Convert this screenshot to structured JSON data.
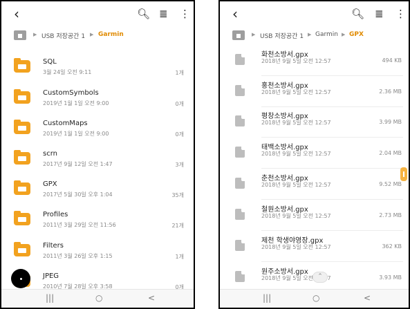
{
  "left": {
    "breadcrumb": {
      "storage": "USB 저장공간 1",
      "current": "Garmin"
    },
    "folders": [
      {
        "name": "SQL",
        "date": "3월 24일 오전 9:11",
        "count": "1개"
      },
      {
        "name": "CustomSymbols",
        "date": "2019년 1월 1일 오전 9:00",
        "count": "0개"
      },
      {
        "name": "CustomMaps",
        "date": "2019년 1월 1일 오전 9:00",
        "count": "0개"
      },
      {
        "name": "scrn",
        "date": "2017년 9월 12일 오전 1:47",
        "count": "3개"
      },
      {
        "name": "GPX",
        "date": "2017년 5월 30일 오후 1:04",
        "count": "35개"
      },
      {
        "name": "Profiles",
        "date": "2011년 3월 29일 오전 11:56",
        "count": "21개"
      },
      {
        "name": "Filters",
        "date": "2011년 3월 26일 오후 1:15",
        "count": "1개"
      },
      {
        "name": "JPEG",
        "date": "2010년 7월 28일 오후 3:58",
        "count": "0개"
      }
    ]
  },
  "right": {
    "breadcrumb": {
      "storage": "USB 저장공간 1",
      "middle": "Garmin",
      "current": "GPX"
    },
    "files": [
      {
        "name": "화천소방서.gpx",
        "date": "2018년 9월 5일 오전 12:57",
        "size": "494 KB"
      },
      {
        "name": "홍천소방서.gpx",
        "date": "2018년 9월 5일 오전 12:57",
        "size": "2.36 MB"
      },
      {
        "name": "평창소방서.gpx",
        "date": "2018년 9월 5일 오전 12:57",
        "size": "3.99 MB"
      },
      {
        "name": "태백소방서.gpx",
        "date": "2018년 9월 5일 오전 12:57",
        "size": "2.04 MB"
      },
      {
        "name": "춘천소방서.gpx",
        "date": "2018년 9월 5일 오전 12:57",
        "size": "9.52 MB"
      },
      {
        "name": "철원소방서.gpx",
        "date": "2018년 9월 5일 오전 12:57",
        "size": "2.73 MB"
      },
      {
        "name": "제천 학생야영장.gpx",
        "date": "2018년 9월 5일 오전 12:57",
        "size": "362 KB"
      },
      {
        "name": "원주소방서.gpx",
        "date": "2018년 9월 5일 오전 12:57",
        "size": "3.93 MB"
      }
    ]
  },
  "icons": {
    "back": "back-arrow-icon",
    "search": "search-icon",
    "sort": "sort-list-icon",
    "more": "more-vertical-icon",
    "home": "home-folder-icon"
  },
  "nav": {
    "recents": "|||",
    "home": "○",
    "back": "<"
  },
  "colors": {
    "folder": "#f2a21f",
    "accent": "#e08a00",
    "file": "#bdbdbd"
  }
}
